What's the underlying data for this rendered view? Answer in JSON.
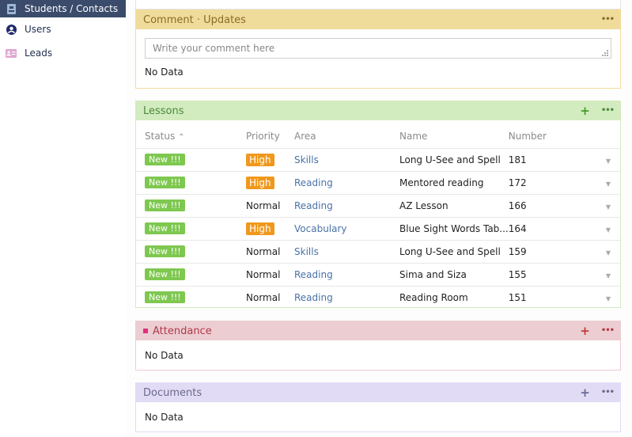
{
  "sidebar": {
    "items": [
      {
        "label": "Students / Contacts",
        "icon": "contact-badge-icon",
        "active": true
      },
      {
        "label": "Users",
        "icon": "user-circle-icon",
        "active": false
      },
      {
        "label": "Leads",
        "icon": "id-card-icon",
        "active": false
      }
    ]
  },
  "comments": {
    "title": "Comment · Updates",
    "placeholder": "Write your comment here",
    "empty": "No Data",
    "color": "#f0dc9a"
  },
  "lessons": {
    "title": "Lessons",
    "color": "#d2ebbf",
    "columns": [
      "Status",
      "Priority",
      "Area",
      "Name",
      "Number"
    ],
    "sort_column": "Status",
    "sort_dir": "asc",
    "rows": [
      {
        "status": "New !!!",
        "priority": "High",
        "area": "Skills",
        "name": "Long U-See and Spell",
        "number": "181"
      },
      {
        "status": "New !!!",
        "priority": "High",
        "area": "Reading",
        "name": "Mentored reading",
        "number": "172"
      },
      {
        "status": "New !!!",
        "priority": "Normal",
        "area": "Reading",
        "name": "AZ Lesson",
        "number": "166"
      },
      {
        "status": "New !!!",
        "priority": "High",
        "area": "Vocabulary",
        "name": "Blue Sight Words Tab...",
        "number": "164"
      },
      {
        "status": "New !!!",
        "priority": "Normal",
        "area": "Skills",
        "name": "Long U-See and Spell",
        "number": "159"
      },
      {
        "status": "New !!!",
        "priority": "Normal",
        "area": "Reading",
        "name": "Sima and Siza",
        "number": "155"
      },
      {
        "status": "New !!!",
        "priority": "Normal",
        "area": "Reading",
        "name": "Reading Room",
        "number": "151"
      }
    ]
  },
  "attendance": {
    "title": "Attendance",
    "empty": "No Data",
    "color": "#eccdd2"
  },
  "documents": {
    "title": "Documents",
    "empty": "No Data",
    "color": "#e2dbf5"
  }
}
